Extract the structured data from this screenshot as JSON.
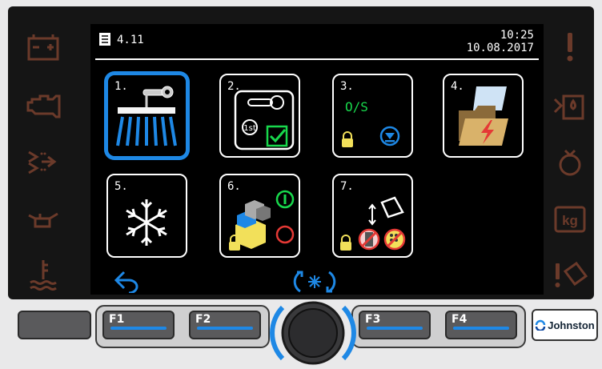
{
  "header": {
    "version": "4.11",
    "time": "10:25",
    "date": "10.08.2017"
  },
  "tiles": [
    {
      "num": "1.",
      "name": "brush-settings"
    },
    {
      "num": "2.",
      "name": "first-service"
    },
    {
      "num": "3.",
      "name": "os-update",
      "text": "O/S"
    },
    {
      "num": "4.",
      "name": "error-log"
    },
    {
      "num": "5.",
      "name": "winter-mode"
    },
    {
      "num": "6.",
      "name": "machine-on-off"
    },
    {
      "num": "7.",
      "name": "remote-tilt"
    }
  ],
  "function_keys": [
    "F1",
    "F2",
    "F3",
    "F4"
  ],
  "brand": "Johnston",
  "colors": {
    "accent": "#1e88e5",
    "ok_green": "#18d84c",
    "alert_red": "#e53935",
    "lock_yellow": "#f2e05a",
    "side_icon": "#6b3a2a"
  },
  "side_icons_left": [
    "battery-icon",
    "engine-icon",
    "exhaust-icon",
    "oil-can-icon",
    "coolant-temp-icon"
  ],
  "side_icons_right": [
    "warning-exclaim-icon",
    "water-tank-icon",
    "hopper-icon",
    "weight-kg-icon",
    "tilt-warning-icon"
  ]
}
